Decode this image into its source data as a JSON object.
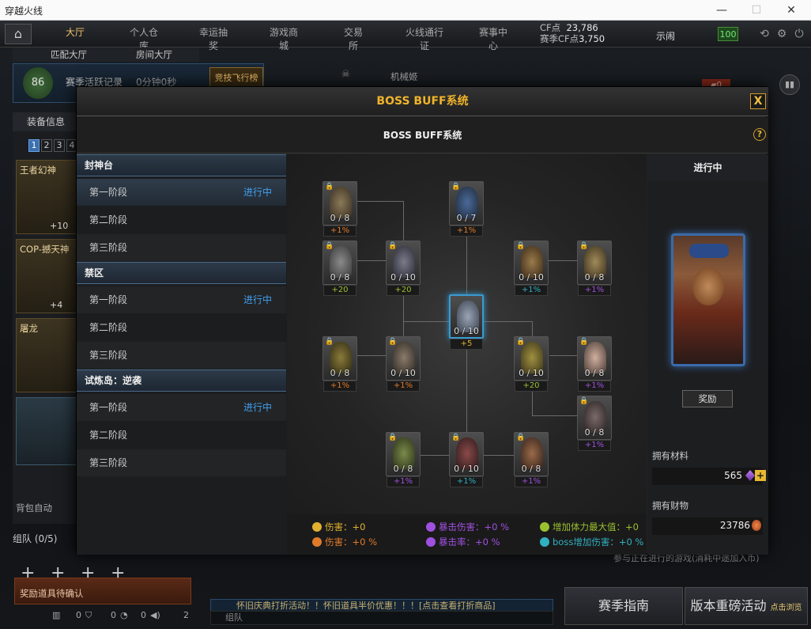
{
  "window": {
    "title": "穿越火线"
  },
  "nav": {
    "tabs": [
      "大厅",
      "个人仓库",
      "幸运抽奖",
      "游戏商城",
      "交易所",
      "火线通行证",
      "赛事中心"
    ],
    "cf_label": "CF点",
    "cf_value": "23,786",
    "season_cf_label": "赛季CF点",
    "season_cf_value": "3,750",
    "username": "示闹",
    "hp": "100"
  },
  "subtabs": [
    "匹配大厅",
    "房间大厅"
  ],
  "rank": {
    "level": "86",
    "season_label": "赛季活跃记录",
    "time": "0分钟0秒",
    "speed": "竞技飞行榜"
  },
  "map_name": "机械姬",
  "left": {
    "equip_header": "装备信息",
    "pages": [
      "1",
      "2",
      "3",
      "4"
    ],
    "weapons": [
      {
        "name": "王者幻神",
        "plus": "+10"
      },
      {
        "name": "COP-撼天神",
        "plus": "+4"
      },
      {
        "name": "屠龙",
        "plus": ""
      }
    ],
    "pack_toggle": "背包自动",
    "team": "组队 (0/5)",
    "reward_confirm": "奖励道具待确认",
    "counts": [
      "0",
      "0",
      "0",
      "2"
    ]
  },
  "marquee": "怀旧庆典打折活动！！怀旧道具半价优惠！！！[点击查看打折商品]",
  "team_chat": "组队",
  "right_note": "参与正在进行的游戏(消耗中途加入币)",
  "bottom_buttons": {
    "guide": "赛季指南",
    "version": "版本重磅活动",
    "version_sub": "点击浏览"
  },
  "modal": {
    "title": "BOSS BUFF系统",
    "close": "X",
    "subtitle": "BOSS BUFF系统",
    "help": "?",
    "groups": [
      {
        "name": "封神台",
        "stages": [
          {
            "label": "第一阶段",
            "status": "进行中"
          },
          {
            "label": "第二阶段",
            "status": ""
          },
          {
            "label": "第三阶段",
            "status": ""
          }
        ]
      },
      {
        "name": "禁区",
        "stages": [
          {
            "label": "第一阶段",
            "status": "进行中"
          },
          {
            "label": "第二阶段",
            "status": ""
          },
          {
            "label": "第三阶段",
            "status": ""
          }
        ]
      },
      {
        "name": "试炼岛：逆袭",
        "stages": [
          {
            "label": "第一阶段",
            "status": "进行中"
          },
          {
            "label": "第二阶段",
            "status": ""
          },
          {
            "label": "第三阶段",
            "status": ""
          }
        ]
      }
    ],
    "nodes": [
      {
        "progress": "0 / 8",
        "bonus": "+1%",
        "color": "#e07a2a",
        "locked": true
      },
      {
        "progress": "0 / 7",
        "bonus": "+1%",
        "color": "#e07a2a",
        "locked": true
      },
      {
        "progress": "0 / 8",
        "bonus": "+20",
        "color": "#9ac030",
        "locked": true
      },
      {
        "progress": "0 / 10",
        "bonus": "+20",
        "color": "#9ac030",
        "locked": true
      },
      {
        "progress": "0 / 10",
        "bonus": "+1%",
        "color": "#30b0c0",
        "locked": true
      },
      {
        "progress": "0 / 8",
        "bonus": "+1%",
        "color": "#a050e0",
        "locked": true
      },
      {
        "progress": "0 / 10",
        "bonus": "+5",
        "color": "#e0b030",
        "locked": false
      },
      {
        "progress": "0 / 8",
        "bonus": "+1%",
        "color": "#e07a2a",
        "locked": true
      },
      {
        "progress": "0 / 10",
        "bonus": "+1%",
        "color": "#e07a2a",
        "locked": true
      },
      {
        "progress": "0 / 10",
        "bonus": "+20",
        "color": "#9ac030",
        "locked": true
      },
      {
        "progress": "0 / 8",
        "bonus": "+1%",
        "color": "#a050e0",
        "locked": true
      },
      {
        "progress": "0 / 8",
        "bonus": "+1%",
        "color": "#a050e0",
        "locked": true
      },
      {
        "progress": "0 / 8",
        "bonus": "+1%",
        "color": "#a050e0",
        "locked": true
      },
      {
        "progress": "0 / 10",
        "bonus": "+1%",
        "color": "#30b0c0",
        "locked": true
      },
      {
        "progress": "0 / 8",
        "bonus": "+1%",
        "color": "#a050e0",
        "locked": true
      }
    ],
    "legend": [
      {
        "label": "伤害：+0",
        "color": "#e0b030"
      },
      {
        "label": "暴击伤害：+0 %",
        "color": "#a050e0"
      },
      {
        "label": "增加体力最大值：+0",
        "color": "#9ac030"
      },
      {
        "label": "伤害：+0 %",
        "color": "#e07a2a"
      },
      {
        "label": "暴击率：+0 %",
        "color": "#a050e0"
      },
      {
        "label": "boss增加伤害：+0 %",
        "color": "#30b0c0"
      }
    ],
    "status_title": "进行中",
    "reward_button": "奖励",
    "materials_label": "拥有材料",
    "materials_value": "565",
    "wealth_label": "拥有财物",
    "wealth_value": "23786"
  },
  "colors": {
    "accent": "#f0b42a",
    "status_blue": "#3fa0f0"
  }
}
